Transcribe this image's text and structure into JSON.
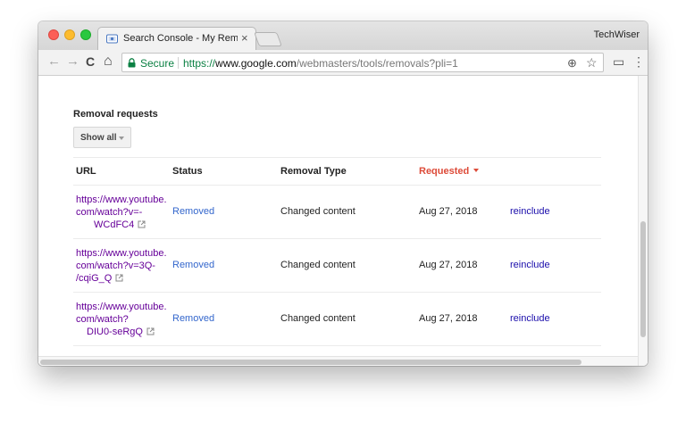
{
  "browser": {
    "tab_title": "Search Console - My Removal",
    "tab_close": "×",
    "profile_name": "TechWiser",
    "nav_back": "←",
    "nav_forward": "→",
    "nav_reload": "C",
    "nav_home": "⌂",
    "secure_label": "Secure",
    "url_scheme": "https://",
    "url_host": "www.google.com",
    "url_path": "/webmasters/tools/removals?pli=1",
    "zoom_icon": "⊕",
    "star_icon": "☆",
    "cast_icon": "▭",
    "menu_icon": "⋮"
  },
  "page": {
    "section_title": "Removal requests",
    "filter_label": "Show all",
    "columns": {
      "url": "URL",
      "status": "Status",
      "removal_type": "Removal Type",
      "requested": "Requested"
    },
    "rows": [
      {
        "url_line1": "https://www.youtube.",
        "url_line2": "com/watch?v=-",
        "url_line3": "WCdFC4",
        "status": "Removed",
        "removal_type": "Changed content",
        "requested": "Aug 27, 2018",
        "action": "reinclude"
      },
      {
        "url_line1": "https://www.youtube.",
        "url_line2": "com/watch?v=3Q-",
        "url_line3": "/cqiG_Q",
        "status": "Removed",
        "removal_type": "Changed content",
        "requested": "Aug 27, 2018",
        "action": "reinclude"
      },
      {
        "url_line1": "https://www.youtube.",
        "url_line2": "com/watch?",
        "url_line3": "DIU0-seRgQ",
        "status": "Removed",
        "removal_type": "Changed content",
        "requested": "Aug 27, 2018",
        "action": "reinclude"
      }
    ]
  },
  "colors": {
    "secure_green": "#0b8043",
    "visited_link": "#660099",
    "status_blue": "#3366cc",
    "sort_red": "#dd4b39"
  }
}
